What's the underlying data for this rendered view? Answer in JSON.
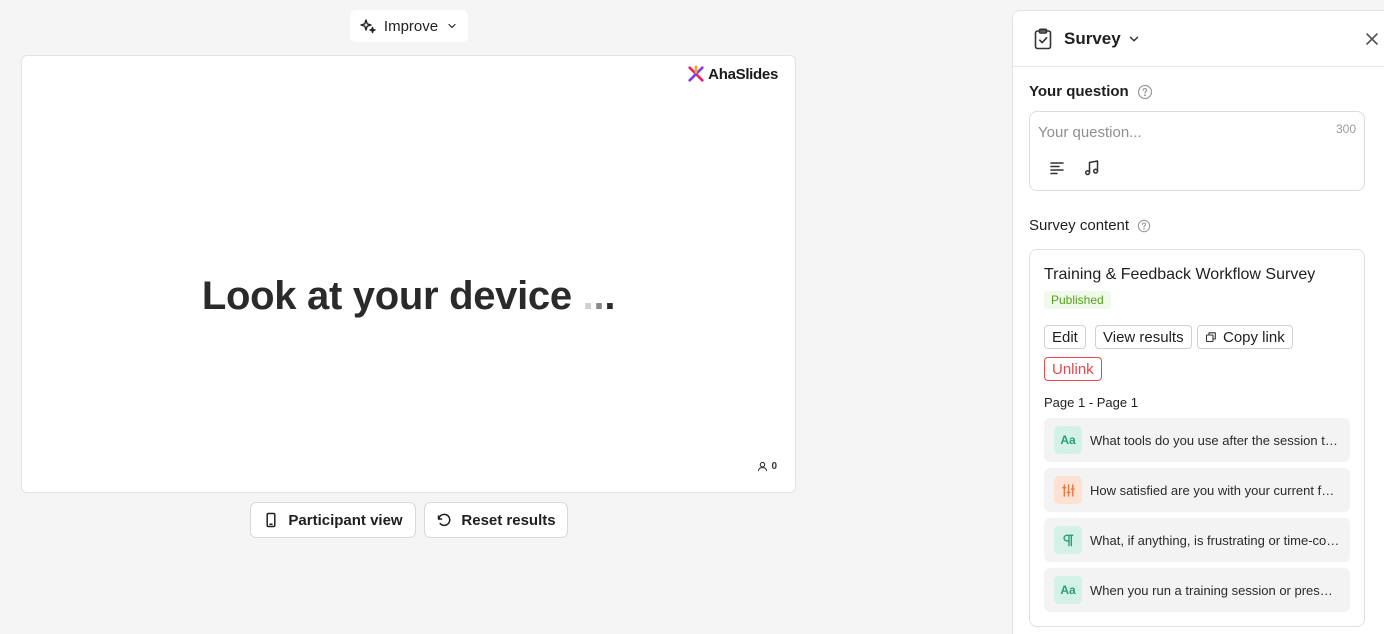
{
  "toolbar": {
    "improve_label": "Improve"
  },
  "slide": {
    "logo_text": "AhaSlides",
    "message": "Look at your device",
    "participant_count": "0"
  },
  "actions": {
    "participant_view_label": "Participant view",
    "reset_results_label": "Reset results"
  },
  "panel": {
    "title": "Survey",
    "question_label": "Your question",
    "question_value": "",
    "question_placeholder": "Your question...",
    "char_limit": "300",
    "content_label": "Survey content",
    "survey": {
      "name": "Training & Feedback Workflow Survey",
      "status": "Published",
      "edit_label": "Edit",
      "view_results_label": "View results",
      "copy_link_label": "Copy link",
      "unlink_label": "Unlink",
      "page_range": "Page 1 - Page 1",
      "questions": [
        {
          "icon": "text-answer-icon",
          "badge": "Aa",
          "text": "What tools do you use after the session to follow up with participants?"
        },
        {
          "icon": "scale-sliders-icon",
          "badge": "",
          "text": "How satisfied are you with your current feedback workflow?"
        },
        {
          "icon": "paragraph-icon",
          "badge": "",
          "text": "What, if anything, is frustrating or time-consuming in your current process?"
        },
        {
          "icon": "text-answer-icon",
          "badge": "Aa",
          "text": "When you run a training session or presentation, how do you collect feedback?"
        }
      ]
    }
  },
  "colors": {
    "background": "#f5f5f5",
    "published": "#52a41a",
    "unlink": "#e5484d",
    "text_badge": "#2a9d76",
    "scale_badge": "#e8743b"
  }
}
